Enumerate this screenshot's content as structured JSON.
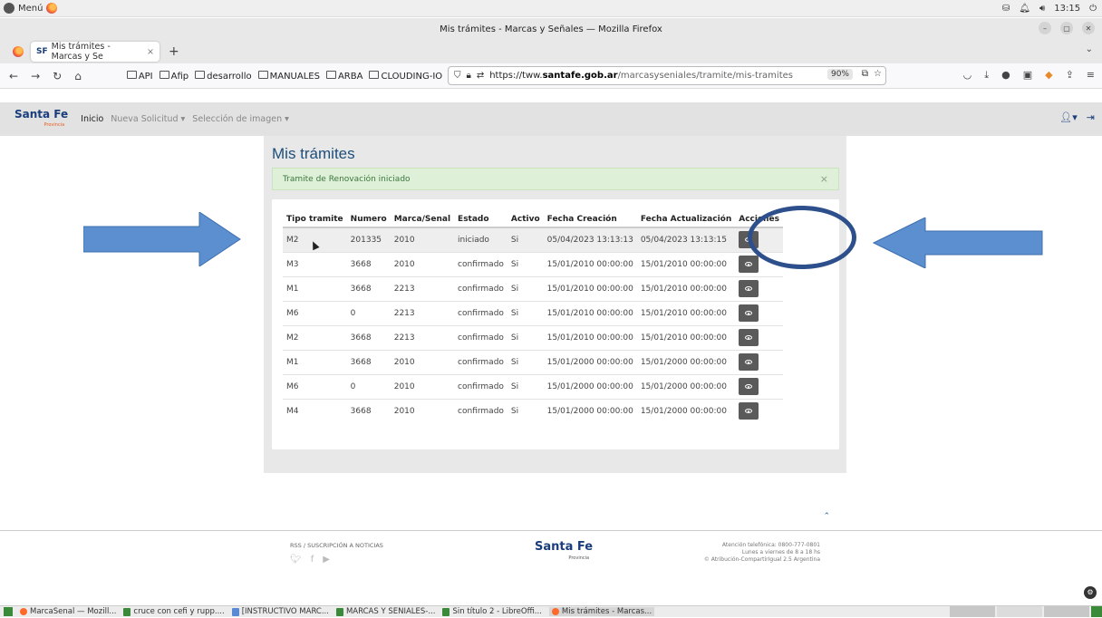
{
  "os": {
    "menu_label": "Menú",
    "clock": "13:15"
  },
  "browser": {
    "window_title": "Mis trámites - Marcas y Señales — Mozilla Firefox",
    "tab_title": "Mis trámites - Marcas y Se",
    "tab_favicon_text": "SF",
    "bookmarks": [
      "API",
      "Afip",
      "desarrollo",
      "MANUALES",
      "ARBA",
      "CLOUDING-IO"
    ],
    "url_host_prefix": "https://tww.",
    "url_domain": "santafe.gob.ar",
    "url_path": "/marcasyseniales/tramite/mis-tramites",
    "zoom": "90%"
  },
  "app": {
    "logo": "Santa Fe",
    "logo_sub": "Provincia",
    "nav": {
      "home": "Inicio",
      "new_request": "Nueva Solicitud",
      "image_select": "Selección de imagen"
    },
    "page_title": "Mis trámites",
    "alert_text": "Tramite de Renovación iniciado",
    "alert_close": "×",
    "table": {
      "headers": [
        "Tipo tramite",
        "Numero",
        "Marca/Senal",
        "Estado",
        "Activo",
        "Fecha Creación",
        "Fecha Actualización",
        "Acciones"
      ],
      "rows": [
        [
          "M2",
          "201335",
          "2010",
          "iniciado",
          "Si",
          "05/04/2023 13:13:13",
          "05/04/2023 13:13:15"
        ],
        [
          "M3",
          "3668",
          "2010",
          "confirmado",
          "Si",
          "15/01/2010 00:00:00",
          "15/01/2010 00:00:00"
        ],
        [
          "M1",
          "3668",
          "2213",
          "confirmado",
          "Si",
          "15/01/2010 00:00:00",
          "15/01/2010 00:00:00"
        ],
        [
          "M6",
          "0",
          "2213",
          "confirmado",
          "Si",
          "15/01/2010 00:00:00",
          "15/01/2010 00:00:00"
        ],
        [
          "M2",
          "3668",
          "2213",
          "confirmado",
          "Si",
          "15/01/2010 00:00:00",
          "15/01/2010 00:00:00"
        ],
        [
          "M1",
          "3668",
          "2010",
          "confirmado",
          "Si",
          "15/01/2000 00:00:00",
          "15/01/2000 00:00:00"
        ],
        [
          "M6",
          "0",
          "2010",
          "confirmado",
          "Si",
          "15/01/2000 00:00:00",
          "15/01/2000 00:00:00"
        ],
        [
          "M4",
          "3668",
          "2010",
          "confirmado",
          "Si",
          "15/01/2000 00:00:00",
          "15/01/2000 00:00:00"
        ]
      ]
    }
  },
  "footer": {
    "rss": "RSS / SUSCRIPCIÓN A NOTICIAS",
    "logo": "Santa Fe",
    "logo_sub": "Provincia",
    "phone": "Atención telefónica: 0800-777-0801",
    "hours": "Lunes a viernes de 8 a 18 hs",
    "license": "© Atribución-CompartirIgual 2.5 Argentina"
  },
  "taskbar": {
    "items": [
      "MarcaSenal — Mozill...",
      "cruce con cefi y rupp....",
      "[INSTRUCTIVO MARC...",
      "MARCAS Y SENIALES-...",
      "Sin título 2 - LibreOffi...",
      "Mis trámites - Marcas..."
    ]
  },
  "annotation_color": "#5b8fcf"
}
